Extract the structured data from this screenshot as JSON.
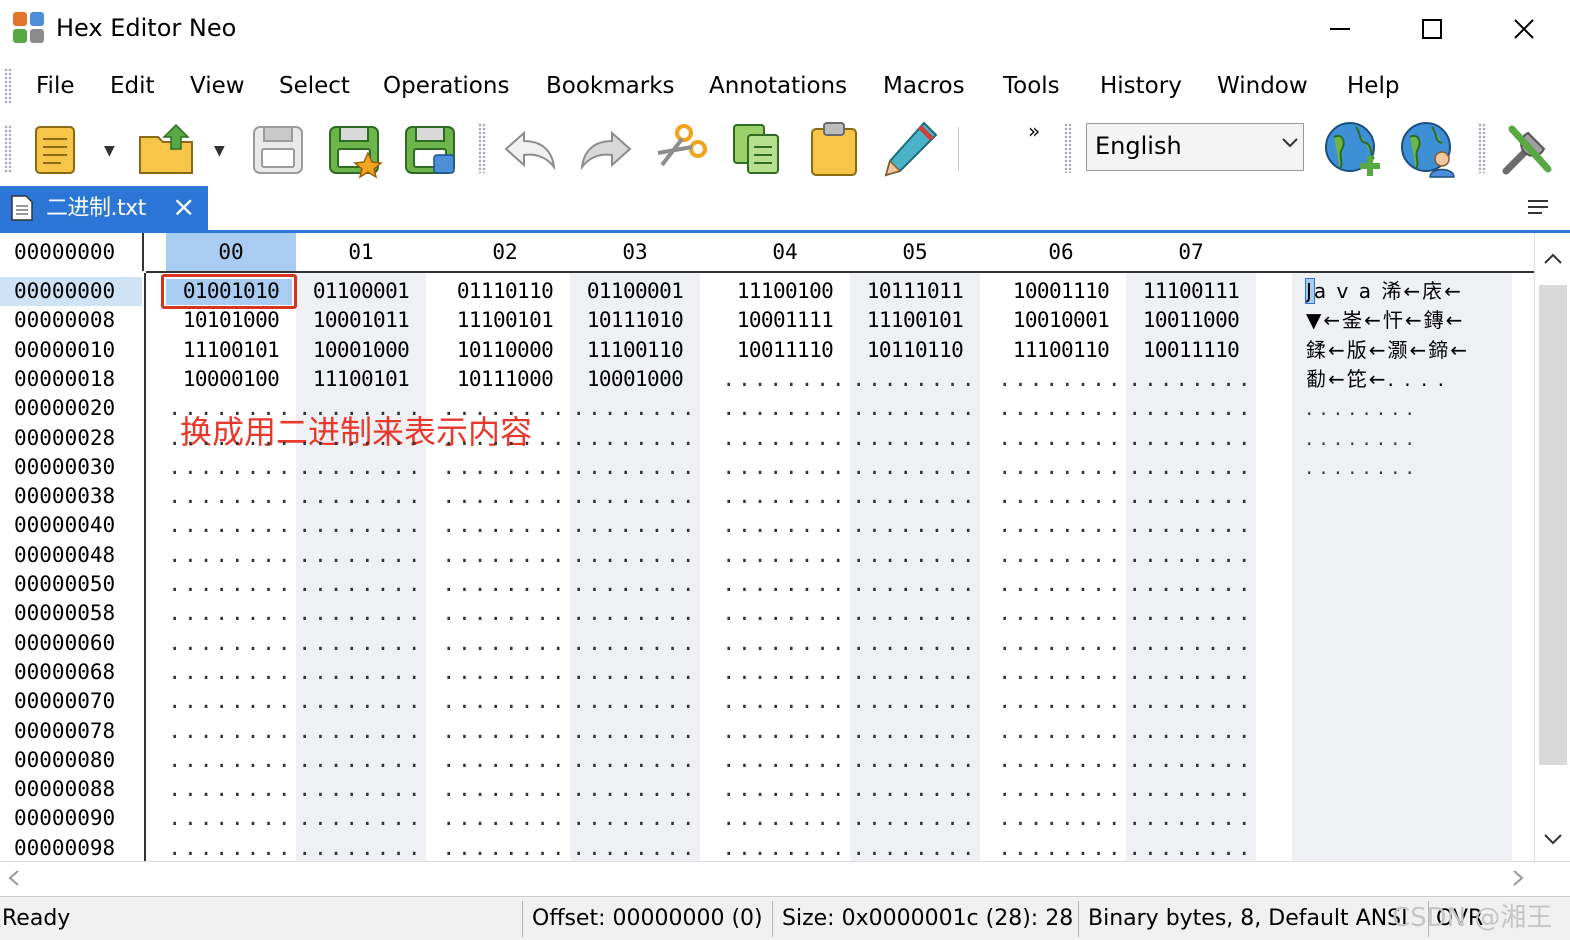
{
  "window": {
    "title": "Hex Editor Neo"
  },
  "menu": [
    "File",
    "Edit",
    "View",
    "Select",
    "Operations",
    "Bookmarks",
    "Annotations",
    "Macros",
    "Tools",
    "History",
    "Window",
    "Help"
  ],
  "toolbar": {
    "icons": [
      "new-file-icon",
      "open-folder-icon",
      "save-icon",
      "save-as-icon",
      "save-all-icon",
      "undo-icon",
      "redo-icon",
      "cut-icon",
      "copy-icon",
      "paste-icon",
      "edit-pencil-icon"
    ],
    "language": "English",
    "right_icons": [
      "globe-add-icon",
      "globe-user-icon",
      "tools-icon"
    ]
  },
  "tab": {
    "label": "二进制.txt"
  },
  "editor": {
    "corner_offset": "00000000",
    "columns": [
      "00",
      "01",
      "02",
      "03",
      "04",
      "05",
      "06",
      "07"
    ],
    "offsets": [
      "00000000",
      "00000008",
      "00000010",
      "00000018",
      "00000020",
      "00000028",
      "00000030",
      "00000038",
      "00000040",
      "00000048",
      "00000050",
      "00000058",
      "00000060",
      "00000068",
      "00000070",
      "00000078",
      "00000080",
      "00000088",
      "00000090",
      "00000098"
    ],
    "rows": [
      [
        "01001010",
        "01100001",
        "01110110",
        "01100001",
        "11100100",
        "10111011",
        "10001110",
        "11100111"
      ],
      [
        "10101000",
        "10001011",
        "11100101",
        "10111010",
        "10001111",
        "11100101",
        "10010001",
        "10011000"
      ],
      [
        "11100101",
        "10001000",
        "10110000",
        "11100110",
        "10011110",
        "10110110",
        "11100110",
        "10011110"
      ],
      [
        "10000100",
        "11100101",
        "10111000",
        "10001000",
        "........",
        "........",
        "........",
        "........"
      ]
    ],
    "empty_cell": "........",
    "text_rows": [
      [
        "J",
        "a v a 浠←庡←"
      ],
      [
        "",
        "▼←崟←忓←鏄←"
      ],
      [
        "",
        "鍒←版←灏←鍗←"
      ],
      [
        "",
        "勫←笓←. . . ."
      ]
    ],
    "empty_text": "........",
    "annotation": "换成用二进制来表示内容"
  },
  "status": {
    "ready": "Ready",
    "offset": "Offset: 00000000 (0)",
    "size": "Size: 0x0000001c (28): 28",
    "mode": "Binary bytes, 8, Default ANSI",
    "ovr": "OVR",
    "watermark": "CSDN @湘王"
  }
}
